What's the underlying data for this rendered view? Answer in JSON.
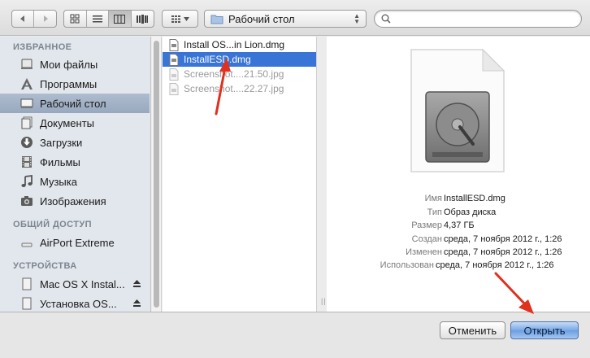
{
  "toolbar": {
    "location": "Рабочий стол",
    "search_placeholder": ""
  },
  "sidebar": {
    "sections": [
      {
        "title": "ИЗБРАННОЕ"
      },
      {
        "title": "ОБЩИЙ ДОСТУП"
      },
      {
        "title": "УСТРОЙСТВА"
      }
    ],
    "favorites": [
      {
        "label": "Мои файлы",
        "icon": "all-my-files-icon"
      },
      {
        "label": "Программы",
        "icon": "applications-icon"
      },
      {
        "label": "Рабочий стол",
        "icon": "desktop-icon",
        "selected": true
      },
      {
        "label": "Документы",
        "icon": "documents-icon"
      },
      {
        "label": "Загрузки",
        "icon": "downloads-icon"
      },
      {
        "label": "Фильмы",
        "icon": "movies-icon"
      },
      {
        "label": "Музыка",
        "icon": "music-icon"
      },
      {
        "label": "Изображения",
        "icon": "pictures-icon"
      }
    ],
    "shared": [
      {
        "label": "AirPort Extreme",
        "icon": "network-device-icon"
      }
    ],
    "devices": [
      {
        "label": "Mac OS X Instal...",
        "icon": "disk-icon"
      },
      {
        "label": "Установка OS...",
        "icon": "disk-icon"
      }
    ]
  },
  "files": [
    {
      "name": "Install OS...in Lion.dmg",
      "selected": false,
      "dim": false
    },
    {
      "name": "InstallESD.dmg",
      "selected": true,
      "dim": false
    },
    {
      "name": "Screenshot....21.50.jpg",
      "selected": false,
      "dim": true
    },
    {
      "name": "Screenshot....22.27.jpg",
      "selected": false,
      "dim": true
    }
  ],
  "preview": {
    "rows": [
      {
        "key": "Имя",
        "value": "InstallESD.dmg"
      },
      {
        "key": "Тип",
        "value": "Образ диска"
      },
      {
        "key": "Размер",
        "value": "4,37 ГБ"
      },
      {
        "key": "Создан",
        "value": "среда, 7 ноября 2012 г., 1:26"
      },
      {
        "key": "Изменен",
        "value": "среда, 7 ноября 2012 г., 1:26"
      },
      {
        "key": "Использован",
        "value": "среда, 7 ноября 2012 г., 1:26"
      }
    ]
  },
  "buttons": {
    "cancel": "Отменить",
    "open": "Открыть"
  },
  "colors": {
    "selection": "#3875d7",
    "sidebar_selection": "#a3b2c7",
    "annotation_arrow": "#e0301e"
  }
}
